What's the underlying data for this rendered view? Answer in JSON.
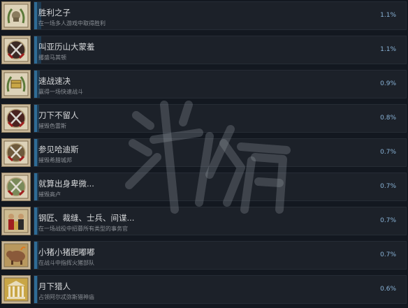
{
  "achievements": [
    {
      "title": "胜利之子",
      "description": "在一场多人游戏中取得胜利",
      "percent": "1.1%",
      "progress": 0.011,
      "icon": "wreath-helmet-icon"
    },
    {
      "title": "叫亚历山大蒙羞",
      "description": "撂盛马其顿",
      "percent": "1.1%",
      "progress": 0.011,
      "icon": "crossed-swords-icon"
    },
    {
      "title": "速战速决",
      "description": "赢得一场快速战斗",
      "percent": "0.9%",
      "progress": 0.009,
      "icon": "wreath-chest-icon"
    },
    {
      "title": "刀下不留人",
      "description": "摧毁色雷斯",
      "percent": "0.8%",
      "progress": 0.008,
      "icon": "crossed-swords-icon"
    },
    {
      "title": "参见哈迪斯",
      "description": "摧毁希腊城邦",
      "percent": "0.7%",
      "progress": 0.007,
      "icon": "crossed-swords-icon"
    },
    {
      "title": "就算出身卑微...",
      "description": "摧毁高卢",
      "percent": "0.7%",
      "progress": 0.007,
      "icon": "crossed-swords-wreath-icon"
    },
    {
      "title": "钢匠、裁缝、士兵、间谍...",
      "description": "在一场战役中招募所有类型的事务官",
      "percent": "0.7%",
      "progress": 0.007,
      "icon": "soldiers-icon"
    },
    {
      "title": "小猪小猪肥嘟嘟",
      "description": "在战斗中指挥火猪部队",
      "percent": "0.7%",
      "progress": 0.007,
      "icon": "pig-icon"
    },
    {
      "title": "月下猎人",
      "description": "占领阿尔忒弥斯猎神庙",
      "percent": "0.6%",
      "progress": 0.006,
      "icon": "temple-icon"
    }
  ],
  "watermark": "游侠网"
}
